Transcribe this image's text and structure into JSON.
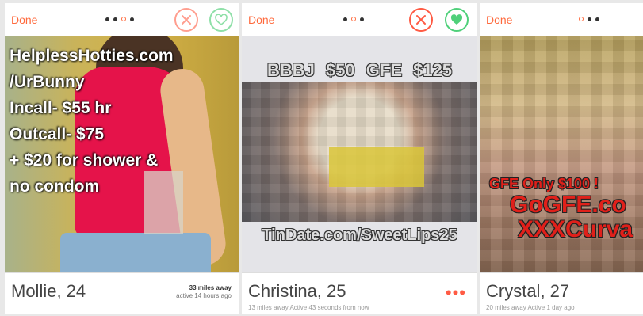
{
  "cards": [
    {
      "done_label": "Done",
      "name": "Mollie, 24",
      "distance": "33 miles away",
      "activity": "active 14 hours ago",
      "overlay_lines": [
        "HelplessHotties.com",
        "/UrBunny",
        "Incall- $55 hr",
        "Outcall- $75",
        "+ $20 for shower &",
        "no condom"
      ]
    },
    {
      "done_label": "Done",
      "name": "Christina, 25",
      "status_line": "13 miles away  Active 43 seconds from now",
      "more_label": "•••",
      "caption_top": "BBBJ $50  GFE $125",
      "caption_bottom": "TinDate.com/SweetLips25"
    },
    {
      "done_label": "Done",
      "name": "Crystal, 27",
      "status_line": "20 miles away  Active 1 day ago",
      "caption_lines": [
        "GFE Only $100 !",
        "GoGFE.co",
        "XXXCurva"
      ]
    }
  ],
  "colors": {
    "accent": "#ff6a3d",
    "reject": "#ff5b44",
    "like": "#4fd07a"
  },
  "icons": [
    "close-icon",
    "heart-icon"
  ]
}
